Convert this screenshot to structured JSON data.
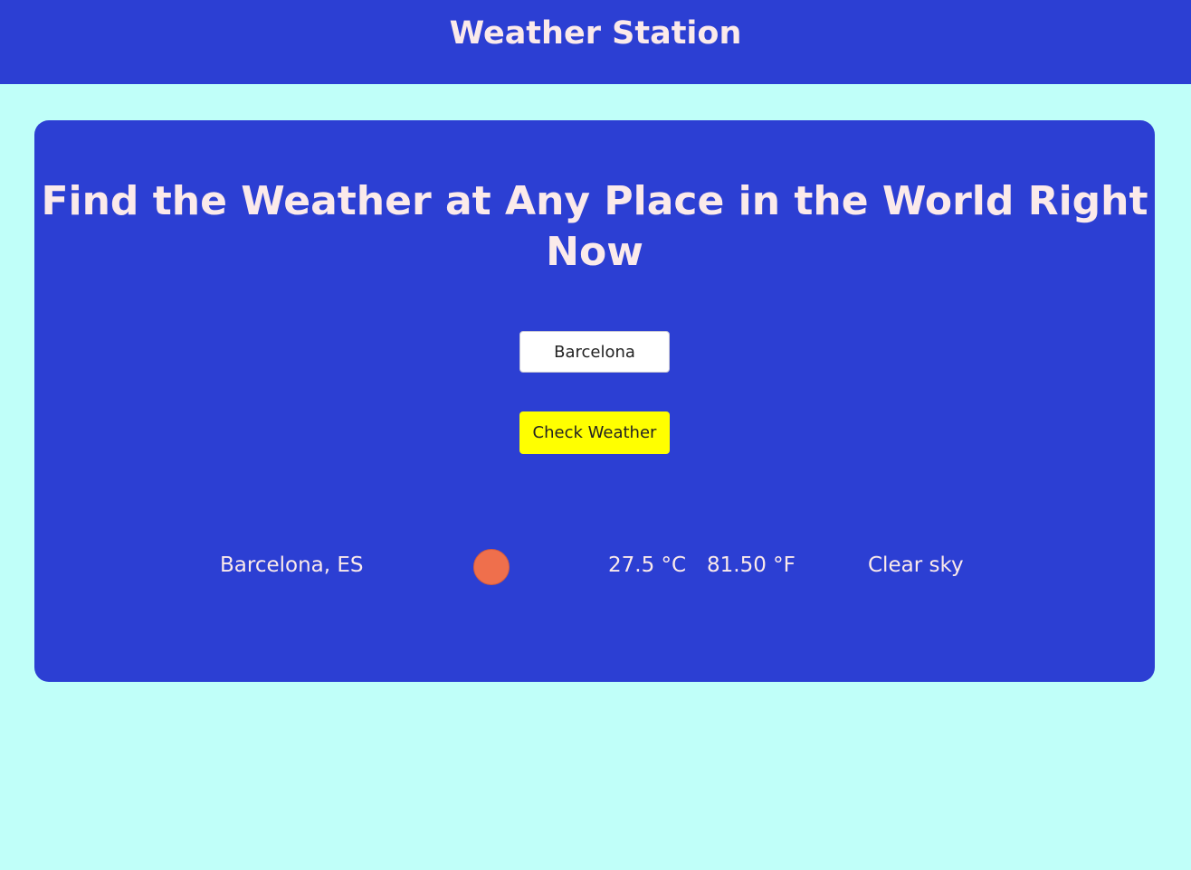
{
  "header": {
    "title": "Weather Station"
  },
  "main": {
    "headline": "Find the Weather at Any Place in the World Right Now",
    "search": {
      "value": "Barcelona",
      "button_label": "Check Weather"
    },
    "result": {
      "location": "Barcelona, ES",
      "icon": "sun-icon",
      "temp_c": "27.5 °C",
      "temp_f": "81.50 °F",
      "condition": "Clear sky"
    }
  },
  "colors": {
    "page_background": "#c0fff9",
    "panel_background": "#2c3fd3",
    "text": "#fbeaea",
    "button": "#ffff00",
    "sun": "#ef6f4c"
  }
}
